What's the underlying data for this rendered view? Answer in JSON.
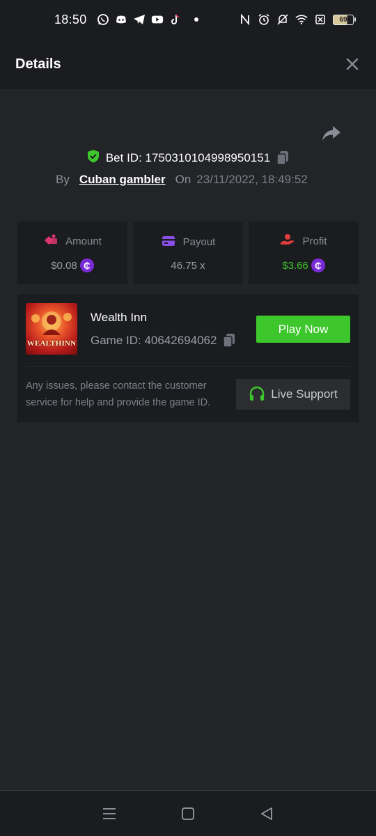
{
  "status_bar": {
    "time": "18:50",
    "battery": "69",
    "app_icons": [
      "whatsapp-icon",
      "discord-icon",
      "telegram-icon",
      "youtube-icon",
      "tiktok-icon"
    ],
    "system_icons": [
      "nfc-icon",
      "alarm-icon",
      "mute-icon",
      "wifi-icon",
      "no-sim-icon",
      "battery-icon"
    ]
  },
  "header": {
    "title": "Details"
  },
  "bet": {
    "bet_id_label": "Bet ID: 1750310104998950151",
    "by_label": "By",
    "username": "Cuban gambler",
    "on_label": "On",
    "date": "23/11/2022, 18:49:52"
  },
  "stats": {
    "amount": {
      "label": "Amount",
      "value": "$0.08"
    },
    "payout": {
      "label": "Payout",
      "value": "46.75 x"
    },
    "profit": {
      "label": "Profit",
      "value": "$3.66"
    }
  },
  "coin_symbol": "₵",
  "game": {
    "name": "Wealth Inn",
    "game_id_label": "Game ID: 40642694062",
    "thumb_text": "WEALTHINN",
    "play_button": "Play Now",
    "issue_text": "Any issues, please contact the customer service for help and provide the game ID.",
    "support_button": "Live Support"
  },
  "colors": {
    "accent_green": "#3ec72c",
    "coin_purple": "#7a2bd8",
    "background": "#232427",
    "card": "#1b1c1f"
  }
}
